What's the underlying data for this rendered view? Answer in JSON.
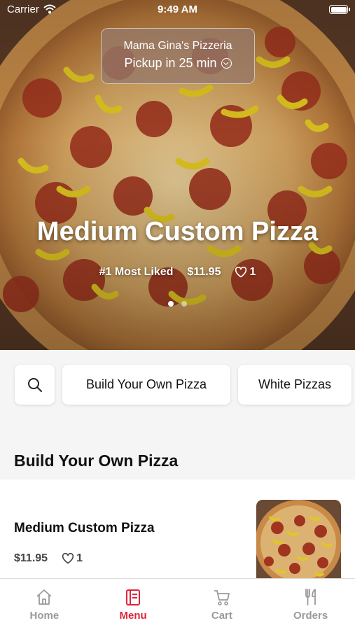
{
  "status_bar": {
    "carrier": "Carrier",
    "time": "9:49 AM"
  },
  "restaurant": {
    "name": "Mama Gina's Pizzeria",
    "pickup": "Pickup in 25 min"
  },
  "hero": {
    "title": "Medium Custom Pizza",
    "badge": "#1 Most Liked",
    "price": "$11.95",
    "likes": "1",
    "page_count": 2,
    "active_page": 0
  },
  "categories": {
    "search_icon": "search-icon",
    "items": [
      "Build Your Own Pizza",
      "White Pizzas"
    ]
  },
  "section": {
    "title": "Build Your Own Pizza"
  },
  "menu_item": {
    "name": "Medium Custom Pizza",
    "price": "$11.95",
    "likes": "1"
  },
  "tab_bar": {
    "tabs": [
      {
        "label": "Home",
        "icon": "home-icon"
      },
      {
        "label": "Menu",
        "icon": "menu-icon"
      },
      {
        "label": "Cart",
        "icon": "cart-icon"
      },
      {
        "label": "Orders",
        "icon": "fork-knife-icon"
      }
    ],
    "active": "Menu",
    "active_color": "#e0243a",
    "inactive_color": "#9a9a9a"
  }
}
